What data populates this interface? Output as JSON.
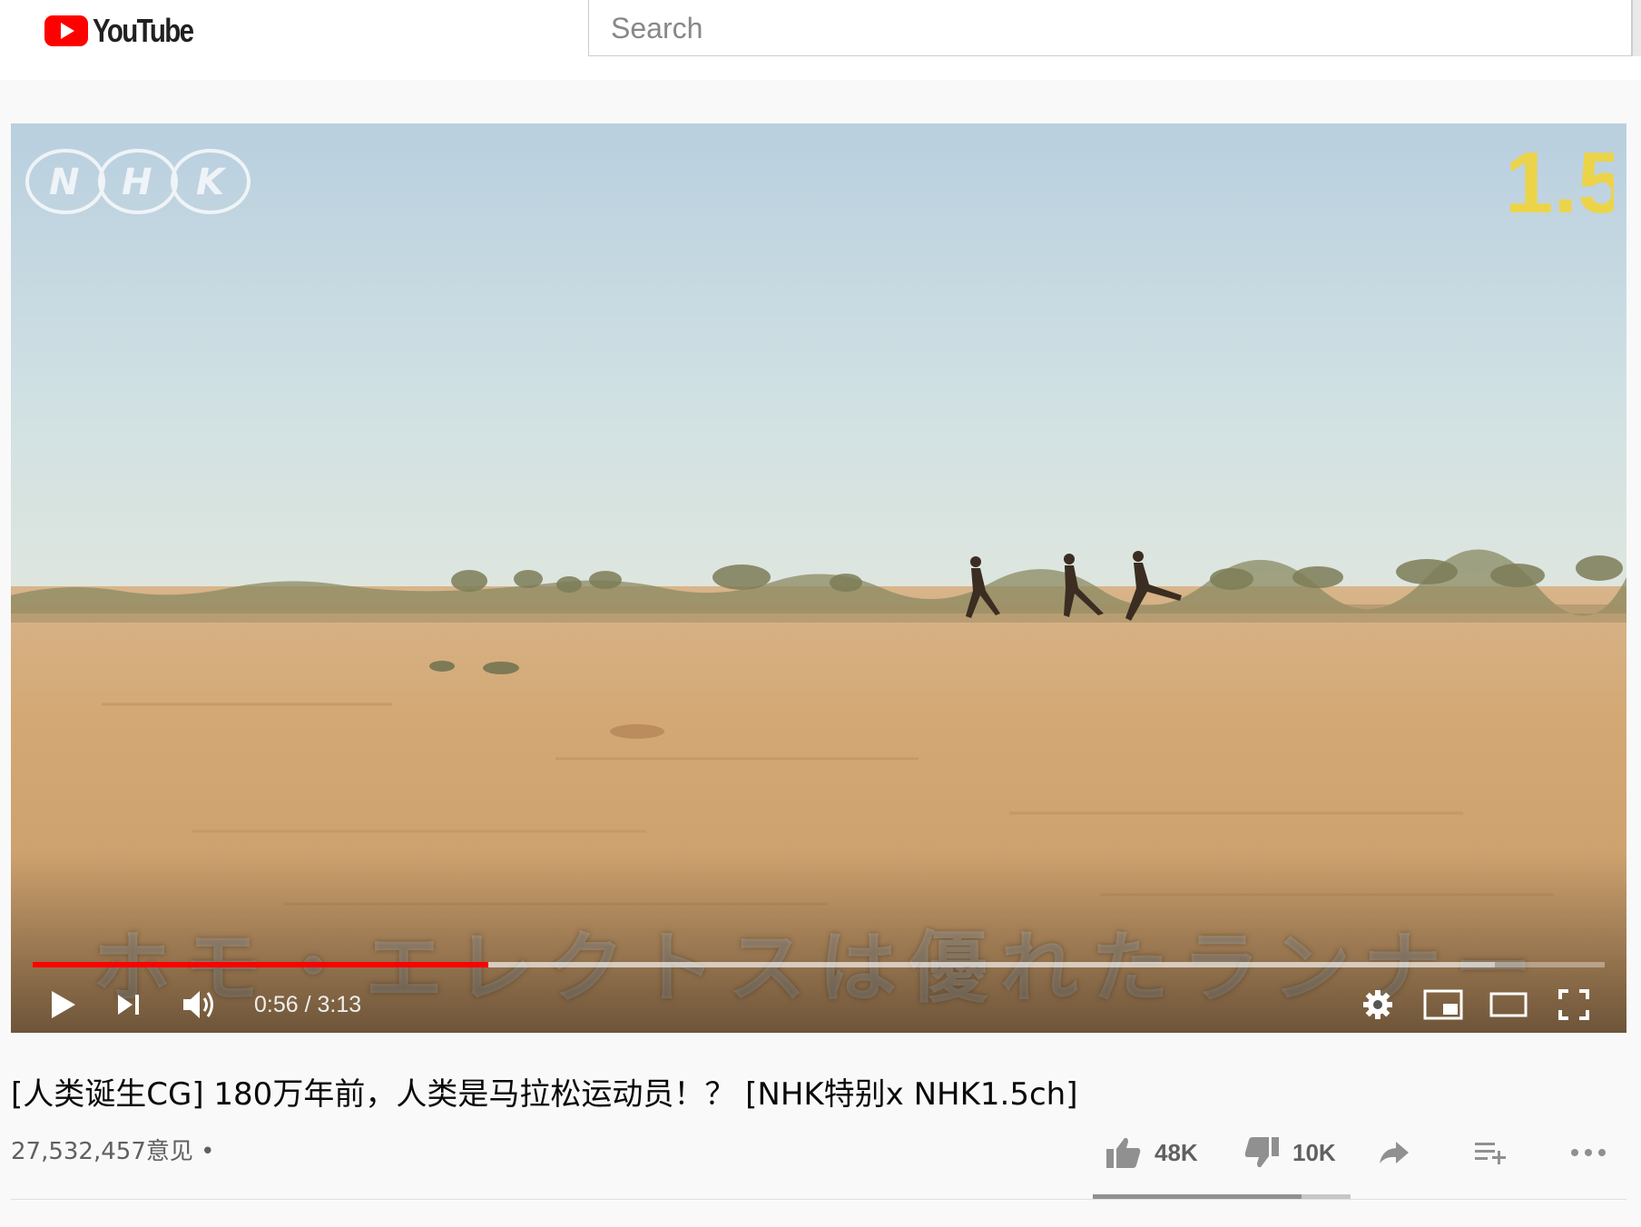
{
  "header": {
    "logo_text": "YouTube",
    "search_placeholder": "Search"
  },
  "player": {
    "channel_watermark": "NHK",
    "channel_badge": "1.5",
    "subtitle": "ホモ・エレクトスは優れたランナー",
    "current_time": "0:56",
    "duration": "3:13",
    "time_display": "0:56 / 3:13",
    "progress_played_fraction": 0.29,
    "progress_loaded_fraction": 0.93,
    "controls": [
      "play-icon",
      "next-icon",
      "volume-icon",
      "settings-icon",
      "miniplayer-icon",
      "theater-icon",
      "fullscreen-icon"
    ],
    "accent_color": "#ff0000"
  },
  "video": {
    "title": "[人类诞生CG] 180万年前，人类是马拉松运动员！？ [NHK特别x NHK1.5ch]",
    "views": "27,532,457意见 •"
  },
  "actions": {
    "likes": "48K",
    "dislikes": "10K",
    "like_fraction": 0.81,
    "icons": [
      "thumb-up-icon",
      "thumb-down-icon",
      "share-icon",
      "add-to-playlist-icon",
      "more-icon"
    ]
  }
}
